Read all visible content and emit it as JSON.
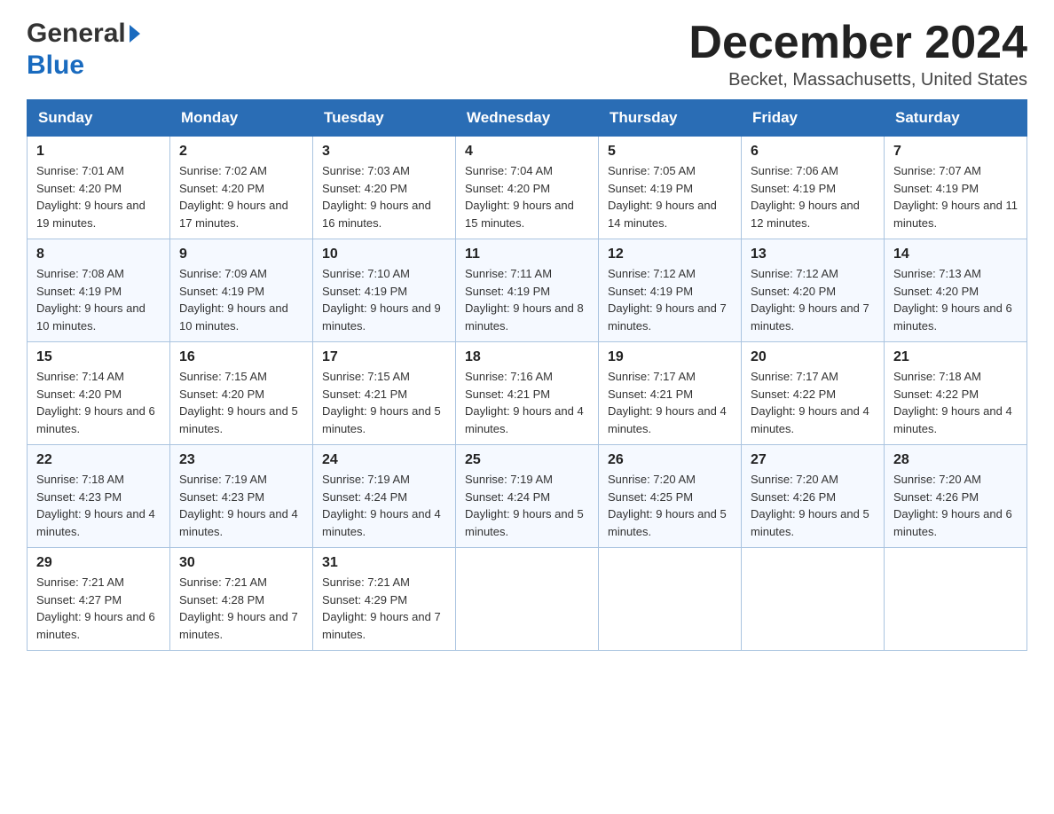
{
  "logo": {
    "general": "General",
    "blue": "Blue",
    "arrow": "▶"
  },
  "title": "December 2024",
  "location": "Becket, Massachusetts, United States",
  "headers": [
    "Sunday",
    "Monday",
    "Tuesday",
    "Wednesday",
    "Thursday",
    "Friday",
    "Saturday"
  ],
  "weeks": [
    [
      {
        "day": "1",
        "sunrise": "Sunrise: 7:01 AM",
        "sunset": "Sunset: 4:20 PM",
        "daylight": "Daylight: 9 hours and 19 minutes."
      },
      {
        "day": "2",
        "sunrise": "Sunrise: 7:02 AM",
        "sunset": "Sunset: 4:20 PM",
        "daylight": "Daylight: 9 hours and 17 minutes."
      },
      {
        "day": "3",
        "sunrise": "Sunrise: 7:03 AM",
        "sunset": "Sunset: 4:20 PM",
        "daylight": "Daylight: 9 hours and 16 minutes."
      },
      {
        "day": "4",
        "sunrise": "Sunrise: 7:04 AM",
        "sunset": "Sunset: 4:20 PM",
        "daylight": "Daylight: 9 hours and 15 minutes."
      },
      {
        "day": "5",
        "sunrise": "Sunrise: 7:05 AM",
        "sunset": "Sunset: 4:19 PM",
        "daylight": "Daylight: 9 hours and 14 minutes."
      },
      {
        "day": "6",
        "sunrise": "Sunrise: 7:06 AM",
        "sunset": "Sunset: 4:19 PM",
        "daylight": "Daylight: 9 hours and 12 minutes."
      },
      {
        "day": "7",
        "sunrise": "Sunrise: 7:07 AM",
        "sunset": "Sunset: 4:19 PM",
        "daylight": "Daylight: 9 hours and 11 minutes."
      }
    ],
    [
      {
        "day": "8",
        "sunrise": "Sunrise: 7:08 AM",
        "sunset": "Sunset: 4:19 PM",
        "daylight": "Daylight: 9 hours and 10 minutes."
      },
      {
        "day": "9",
        "sunrise": "Sunrise: 7:09 AM",
        "sunset": "Sunset: 4:19 PM",
        "daylight": "Daylight: 9 hours and 10 minutes."
      },
      {
        "day": "10",
        "sunrise": "Sunrise: 7:10 AM",
        "sunset": "Sunset: 4:19 PM",
        "daylight": "Daylight: 9 hours and 9 minutes."
      },
      {
        "day": "11",
        "sunrise": "Sunrise: 7:11 AM",
        "sunset": "Sunset: 4:19 PM",
        "daylight": "Daylight: 9 hours and 8 minutes."
      },
      {
        "day": "12",
        "sunrise": "Sunrise: 7:12 AM",
        "sunset": "Sunset: 4:19 PM",
        "daylight": "Daylight: 9 hours and 7 minutes."
      },
      {
        "day": "13",
        "sunrise": "Sunrise: 7:12 AM",
        "sunset": "Sunset: 4:20 PM",
        "daylight": "Daylight: 9 hours and 7 minutes."
      },
      {
        "day": "14",
        "sunrise": "Sunrise: 7:13 AM",
        "sunset": "Sunset: 4:20 PM",
        "daylight": "Daylight: 9 hours and 6 minutes."
      }
    ],
    [
      {
        "day": "15",
        "sunrise": "Sunrise: 7:14 AM",
        "sunset": "Sunset: 4:20 PM",
        "daylight": "Daylight: 9 hours and 6 minutes."
      },
      {
        "day": "16",
        "sunrise": "Sunrise: 7:15 AM",
        "sunset": "Sunset: 4:20 PM",
        "daylight": "Daylight: 9 hours and 5 minutes."
      },
      {
        "day": "17",
        "sunrise": "Sunrise: 7:15 AM",
        "sunset": "Sunset: 4:21 PM",
        "daylight": "Daylight: 9 hours and 5 minutes."
      },
      {
        "day": "18",
        "sunrise": "Sunrise: 7:16 AM",
        "sunset": "Sunset: 4:21 PM",
        "daylight": "Daylight: 9 hours and 4 minutes."
      },
      {
        "day": "19",
        "sunrise": "Sunrise: 7:17 AM",
        "sunset": "Sunset: 4:21 PM",
        "daylight": "Daylight: 9 hours and 4 minutes."
      },
      {
        "day": "20",
        "sunrise": "Sunrise: 7:17 AM",
        "sunset": "Sunset: 4:22 PM",
        "daylight": "Daylight: 9 hours and 4 minutes."
      },
      {
        "day": "21",
        "sunrise": "Sunrise: 7:18 AM",
        "sunset": "Sunset: 4:22 PM",
        "daylight": "Daylight: 9 hours and 4 minutes."
      }
    ],
    [
      {
        "day": "22",
        "sunrise": "Sunrise: 7:18 AM",
        "sunset": "Sunset: 4:23 PM",
        "daylight": "Daylight: 9 hours and 4 minutes."
      },
      {
        "day": "23",
        "sunrise": "Sunrise: 7:19 AM",
        "sunset": "Sunset: 4:23 PM",
        "daylight": "Daylight: 9 hours and 4 minutes."
      },
      {
        "day": "24",
        "sunrise": "Sunrise: 7:19 AM",
        "sunset": "Sunset: 4:24 PM",
        "daylight": "Daylight: 9 hours and 4 minutes."
      },
      {
        "day": "25",
        "sunrise": "Sunrise: 7:19 AM",
        "sunset": "Sunset: 4:24 PM",
        "daylight": "Daylight: 9 hours and 5 minutes."
      },
      {
        "day": "26",
        "sunrise": "Sunrise: 7:20 AM",
        "sunset": "Sunset: 4:25 PM",
        "daylight": "Daylight: 9 hours and 5 minutes."
      },
      {
        "day": "27",
        "sunrise": "Sunrise: 7:20 AM",
        "sunset": "Sunset: 4:26 PM",
        "daylight": "Daylight: 9 hours and 5 minutes."
      },
      {
        "day": "28",
        "sunrise": "Sunrise: 7:20 AM",
        "sunset": "Sunset: 4:26 PM",
        "daylight": "Daylight: 9 hours and 6 minutes."
      }
    ],
    [
      {
        "day": "29",
        "sunrise": "Sunrise: 7:21 AM",
        "sunset": "Sunset: 4:27 PM",
        "daylight": "Daylight: 9 hours and 6 minutes."
      },
      {
        "day": "30",
        "sunrise": "Sunrise: 7:21 AM",
        "sunset": "Sunset: 4:28 PM",
        "daylight": "Daylight: 9 hours and 7 minutes."
      },
      {
        "day": "31",
        "sunrise": "Sunrise: 7:21 AM",
        "sunset": "Sunset: 4:29 PM",
        "daylight": "Daylight: 9 hours and 7 minutes."
      },
      null,
      null,
      null,
      null
    ]
  ]
}
